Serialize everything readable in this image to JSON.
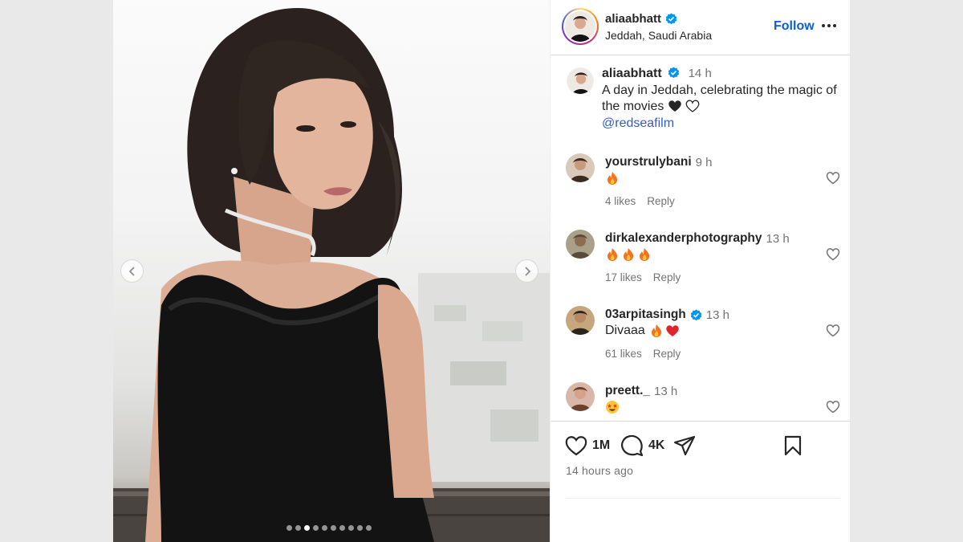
{
  "post": {
    "username": "aliaabhatt",
    "location": "Jeddah, Saudi Arabia",
    "follow_label": "Follow",
    "caption_time": "14 h",
    "caption_text": "A day in Jeddah, celebrating the magic of the movies",
    "mention": "@redseafilm"
  },
  "carousel": {
    "dot_count": 10,
    "active_dot": 2
  },
  "comments": [
    {
      "username": "yourstrulybani",
      "time": "9 h",
      "text": "",
      "emoji": [
        "fire"
      ],
      "likes": "4 likes",
      "reply": "Reply",
      "verified": false
    },
    {
      "username": "dirkalexanderphotography",
      "time": "13 h",
      "text": "",
      "emoji": [
        "fire",
        "fire",
        "fire"
      ],
      "likes": "17 likes",
      "reply": "Reply",
      "verified": false
    },
    {
      "username": "03arpitasingh",
      "time": "13 h",
      "text": "Divaaa",
      "emoji": [
        "fire",
        "red-heart"
      ],
      "likes": "61 likes",
      "reply": "Reply",
      "verified": true
    },
    {
      "username": "preett._",
      "time": "13 h",
      "text": "",
      "emoji": [
        "star-struck"
      ],
      "likes": "",
      "reply": "",
      "verified": false
    }
  ],
  "actions": {
    "likes": "1M",
    "comments": "4K",
    "time_ago": "14 hours ago"
  },
  "colors": {
    "accent_blue": "#0b5fd6",
    "mention_blue": "#2f5ec8",
    "verified_blue": "#0095f6",
    "muted_text": "#737373"
  }
}
